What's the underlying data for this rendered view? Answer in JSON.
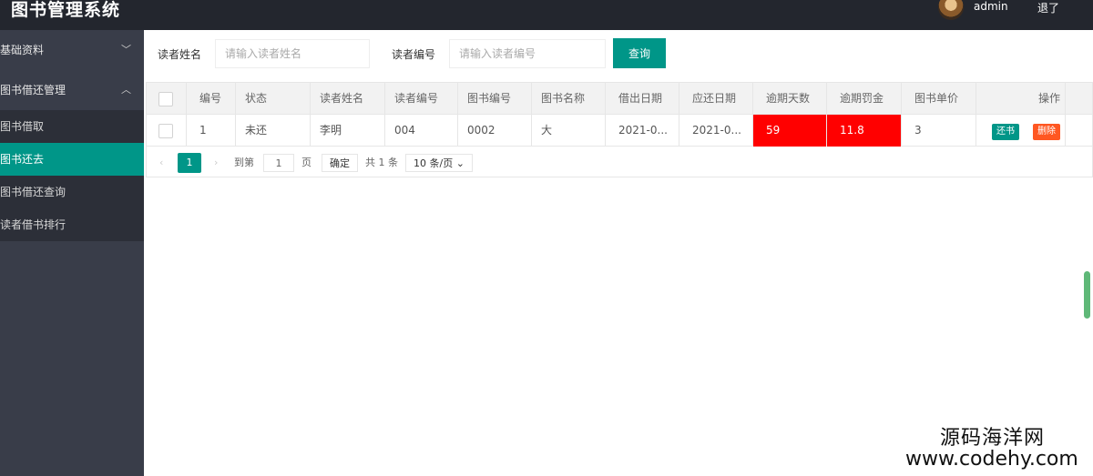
{
  "header": {
    "title": "图书管理系统",
    "username": "admin",
    "logout": "退了"
  },
  "sidebar": {
    "groups": [
      {
        "label": "基础资料",
        "chevron": "﹀"
      },
      {
        "label": "图书借还管理",
        "chevron": "︿"
      }
    ],
    "items": [
      "图书借取",
      "图书还去",
      "图书借还查询",
      "读者借书排行"
    ],
    "active_index": 1
  },
  "filter": {
    "name_label": "读者姓名",
    "name_placeholder": "请输入读者姓名",
    "id_label": "读者编号",
    "id_placeholder": "请输入读者编号",
    "query_button": "查询"
  },
  "table": {
    "headers": [
      "编号",
      "状态",
      "读者姓名",
      "读者编号",
      "图书编号",
      "图书名称",
      "借出日期",
      "应还日期",
      "逾期天数",
      "逾期罚金",
      "图书单价",
      "操作"
    ],
    "rows": [
      {
        "id": "1",
        "status": "未还",
        "reader_name": "李明",
        "reader_id": "004",
        "book_id": "0002",
        "book_name": "大",
        "borrow_date": "2021-0...",
        "due_date": "2021-0...",
        "overdue_days": "59",
        "fine": "11.8",
        "price": "3",
        "return_btn": "还书",
        "delete_btn": "删除"
      }
    ]
  },
  "pager": {
    "current": "1",
    "goto_label": "到第",
    "page_value": "1",
    "page_unit": "页",
    "confirm": "确定",
    "total": "共 1 条",
    "per_page": "10 条/页"
  },
  "colors": {
    "header_bg": "#23262e",
    "sidebar_bg": "#393d49",
    "accent": "#009688",
    "overdue": "#ff0000",
    "delete": "#ff5722"
  },
  "watermark": {
    "line1": "源码海洋网",
    "line2": "www.codehy.com"
  }
}
